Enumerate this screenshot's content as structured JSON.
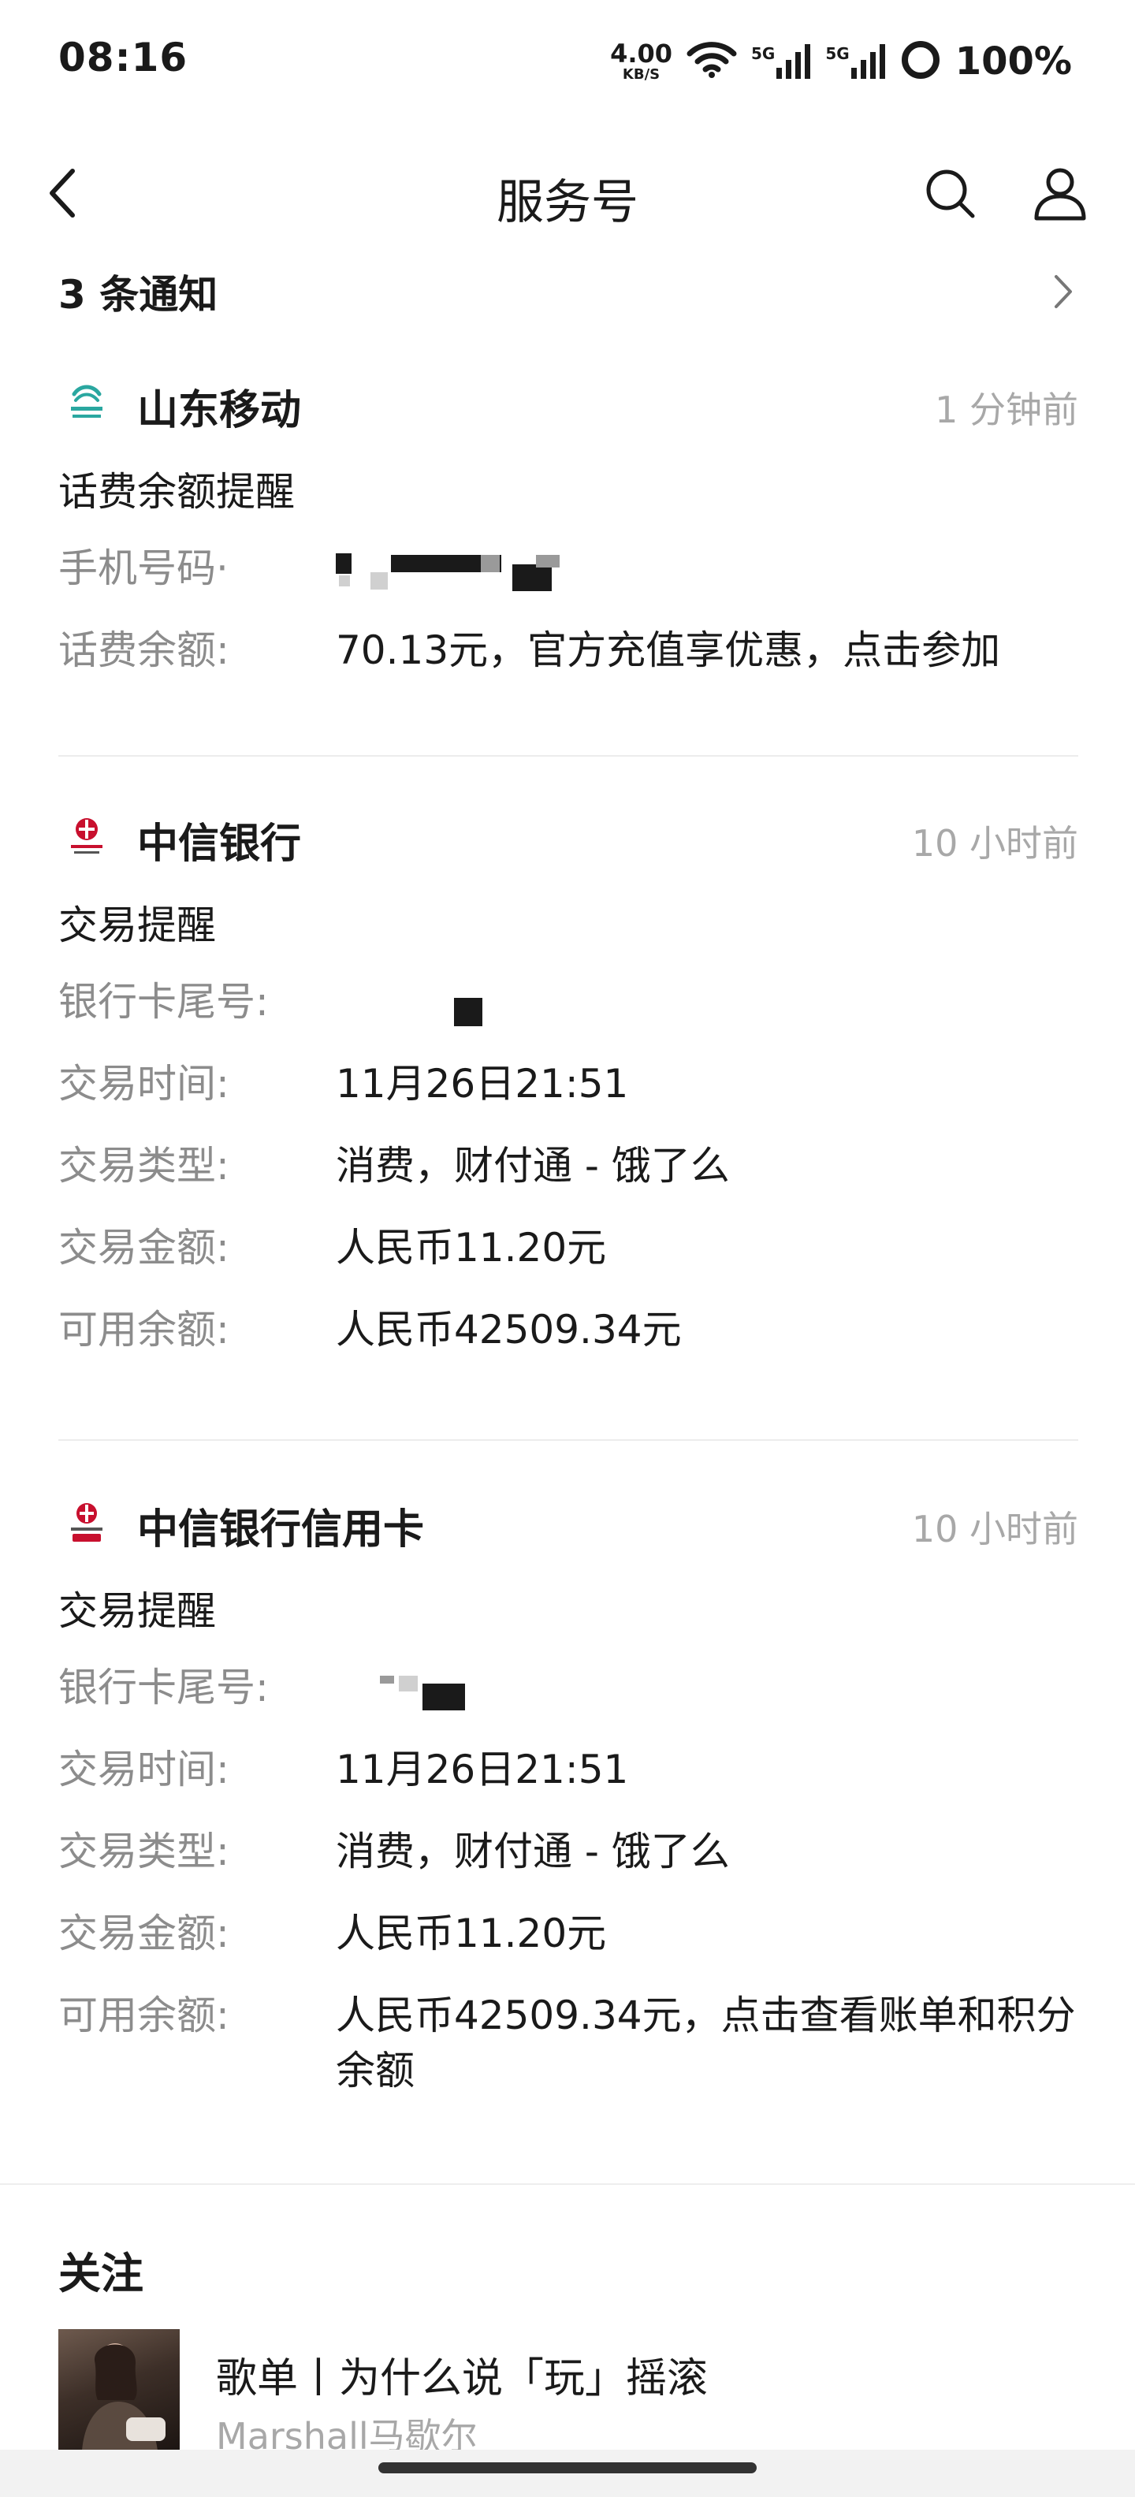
{
  "status_bar": {
    "time": "08:16",
    "net_speed_value": "4.00",
    "net_speed_unit": "KB/S",
    "sim1_tag": "5G",
    "sim2_tag": "5G",
    "battery": "100%"
  },
  "nav": {
    "title": "服务号"
  },
  "notice": {
    "text": "3 条通知"
  },
  "cards": [
    {
      "sender": "山东移动",
      "time_ago": "1 分钟前",
      "subtitle": "话费余额提醒",
      "rows": [
        {
          "key": "手机号码·",
          "value": ""
        },
        {
          "key": "话费余额:",
          "value": "70.13元，官方充值享优惠，点击参加"
        }
      ]
    },
    {
      "sender": "中信银行",
      "time_ago": "10 小时前",
      "subtitle": "交易提醒",
      "rows": [
        {
          "key": "银行卡尾号:",
          "value": ""
        },
        {
          "key": "交易时间:",
          "value": "11月26日21:51"
        },
        {
          "key": "交易类型:",
          "value": "消费，财付通 - 饿了么"
        },
        {
          "key": "交易金额:",
          "value": "人民币11.20元"
        },
        {
          "key": "可用余额:",
          "value": "人民币42509.34元"
        }
      ]
    },
    {
      "sender": "中信银行信用卡",
      "time_ago": "10 小时前",
      "subtitle": "交易提醒",
      "rows": [
        {
          "key": "银行卡尾号:",
          "value": ""
        },
        {
          "key": "交易时间:",
          "value": "11月26日21:51"
        },
        {
          "key": "交易类型:",
          "value": "消费，财付通 - 饿了么"
        },
        {
          "key": "交易金额:",
          "value": "人民币11.20元"
        },
        {
          "key": "可用余额:",
          "value": "人民币42509.34元，点击查看账单和积分余额"
        }
      ]
    }
  ],
  "follow": {
    "title": "关注",
    "items": [
      {
        "title": "歌单丨为什么说「玩」摇滚",
        "author": "Marshall马歇尔"
      }
    ]
  },
  "colors": {
    "text_primary": "#1a1a1a",
    "text_secondary": "#8c8c8c",
    "text_time": "#a8a8a8",
    "divider": "#ececec",
    "mobile_green": "#2aa7a0",
    "citic_red": "#c8102e"
  },
  "icons": {
    "back": "chevron-left-icon",
    "search": "search-icon",
    "profile": "person-icon",
    "notice_more": "chevron-right-icon",
    "wifi": "wifi-icon",
    "battery": "battery-ring-icon"
  }
}
